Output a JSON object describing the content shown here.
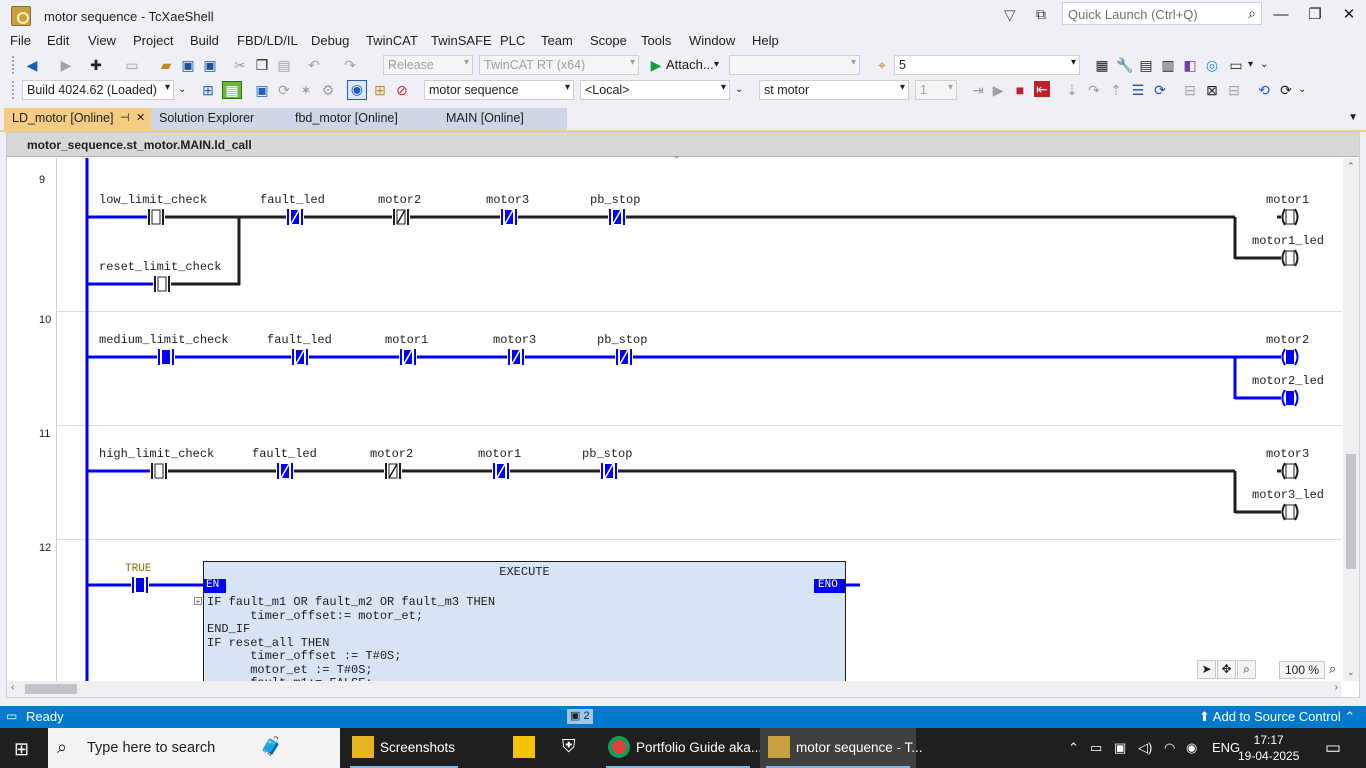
{
  "window": {
    "title": "motor sequence - TcXaeShell",
    "quick_launch_placeholder": "Quick Launch (Ctrl+Q)",
    "minimize": "—",
    "maximize": "❐",
    "close": "✕"
  },
  "menu": [
    "File",
    "Edit",
    "View",
    "Project",
    "Build",
    "FBD/LD/IL",
    "Debug",
    "TwinCAT",
    "TwinSAFE",
    "PLC",
    "Team",
    "Scope",
    "Tools",
    "Window",
    "Help"
  ],
  "toolbar1": {
    "config": "Release",
    "platform": "TwinCAT RT (x64)",
    "attach": "Attach...",
    "search_value": "5"
  },
  "toolbar2": {
    "build": "Build 4024.62 (Loaded)",
    "project": "motor sequence",
    "target": "<Local>",
    "plc_project": "st motor",
    "task_num": "1"
  },
  "tabs": [
    {
      "label": "LD_motor [Online]",
      "pin": "⊣",
      "close": "✕"
    },
    {
      "label": "Solution Explorer"
    },
    {
      "label": "fbd_motor [Online]"
    },
    {
      "label": "MAIN [Online]"
    }
  ],
  "editor": {
    "path": "motor_sequence.st_motor.MAIN.ld_call",
    "networks": [
      "9",
      "10",
      "11",
      "12"
    ],
    "rungs": [
      {
        "contacts": [
          "low_limit_check",
          "fault_led",
          "motor2",
          "motor3",
          "pb_stop"
        ],
        "parallel_contact": "reset_limit_check",
        "coils": [
          "motor1",
          "motor1_led"
        ]
      },
      {
        "contacts": [
          "medium_limit_check",
          "fault_led",
          "motor1",
          "motor3",
          "pb_stop"
        ],
        "coils": [
          "motor2",
          "motor2_led"
        ]
      },
      {
        "contacts": [
          "high_limit_check",
          "fault_led",
          "motor2",
          "motor1",
          "pb_stop"
        ],
        "coils": [
          "motor3",
          "motor3_led"
        ]
      }
    ],
    "exec_rung": {
      "contact": "TRUE",
      "block_title": "EXECUTE",
      "en": "EN",
      "eno": "ENO",
      "code": "IF fault_m1 OR fault_m2 OR fault_m3 THEN\n      timer_offset:= motor_et;\nEND_IF\nIF reset_all THEN\n      timer_offset := T#0S;\n      motor_et := T#0S;\n      fault_m1:= FALSE;"
    },
    "zoom": "100 %"
  },
  "status": {
    "text": "Ready",
    "tasks": "2",
    "source_control": "Add to Source Control"
  },
  "taskbar": {
    "search_placeholder": "Type here to search",
    "apps": [
      {
        "label": "Screenshots"
      },
      {
        "label": ""
      },
      {
        "label": ""
      },
      {
        "label": "Portfolio Guide aka..."
      },
      {
        "label": "motor sequence - T..."
      }
    ],
    "lang": "ENG",
    "time": "17:17",
    "date": "19-04-2025"
  },
  "colors": {
    "accent": "#007acc",
    "active_tab": "#f5cc84",
    "energized": "#0000ff",
    "fb_background": "#d7e4f4"
  }
}
